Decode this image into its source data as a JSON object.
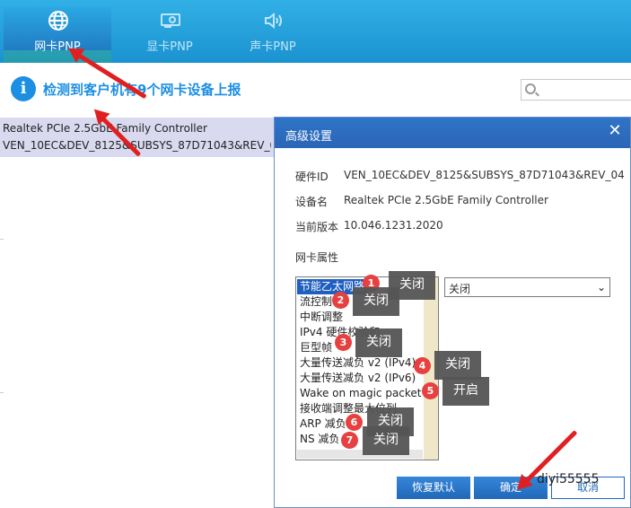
{
  "tabs": [
    {
      "label": "网卡PNP",
      "icon": "globe-icon",
      "active": true
    },
    {
      "label": "显卡PNP",
      "icon": "graphics-card-icon",
      "active": false
    },
    {
      "label": "声卡PNP",
      "icon": "speaker-icon",
      "active": false
    }
  ],
  "info": {
    "text": "检测到客户机有9个网卡设备上报"
  },
  "device_list": [
    {
      "line1": "Realtek PCIe 2.5GbE Family Controller",
      "line2": "VEN_10EC&DEV_8125&SUBSYS_87D71043&REV_04"
    }
  ],
  "dialog": {
    "title": "高级设置",
    "close": "✕",
    "fields": [
      {
        "label": "硬件ID",
        "value": "VEN_10EC&DEV_8125&SUBSYS_87D71043&REV_04"
      },
      {
        "label": "设备名",
        "value": "Realtek PCIe 2.5GbE Family Controller"
      },
      {
        "label": "当前版本",
        "value": "10.046.1231.2020"
      }
    ],
    "properties_label": "网卡属性",
    "properties": [
      "节能乙太网路",
      "流控制",
      "中断调整",
      "IPv4 硬件校验和",
      "巨型帧",
      "大量传送减负 v2 (IPv4)",
      "大量传送减负 v2 (IPv6)",
      "Wake on magic packet",
      "接收端调整最大位列",
      "ARP 减负",
      "NS 减负"
    ],
    "selected_value": "关闭",
    "buttons": {
      "restore": "恢复默认",
      "ok": "确定",
      "cancel": "取消"
    }
  },
  "annotations": [
    {
      "num": "1",
      "text": "关闭"
    },
    {
      "num": "2",
      "text": "关闭"
    },
    {
      "num": "3",
      "text": "关闭"
    },
    {
      "num": "4",
      "text": "关闭"
    },
    {
      "num": "5",
      "text": "开启"
    },
    {
      "num": "6",
      "text": "关闭"
    },
    {
      "num": "7",
      "text": "关闭"
    }
  ],
  "watermark": "diyi55555",
  "colors": {
    "accent": "#1c8fe3",
    "badge": "#e64040",
    "arrow": "#e02020"
  }
}
